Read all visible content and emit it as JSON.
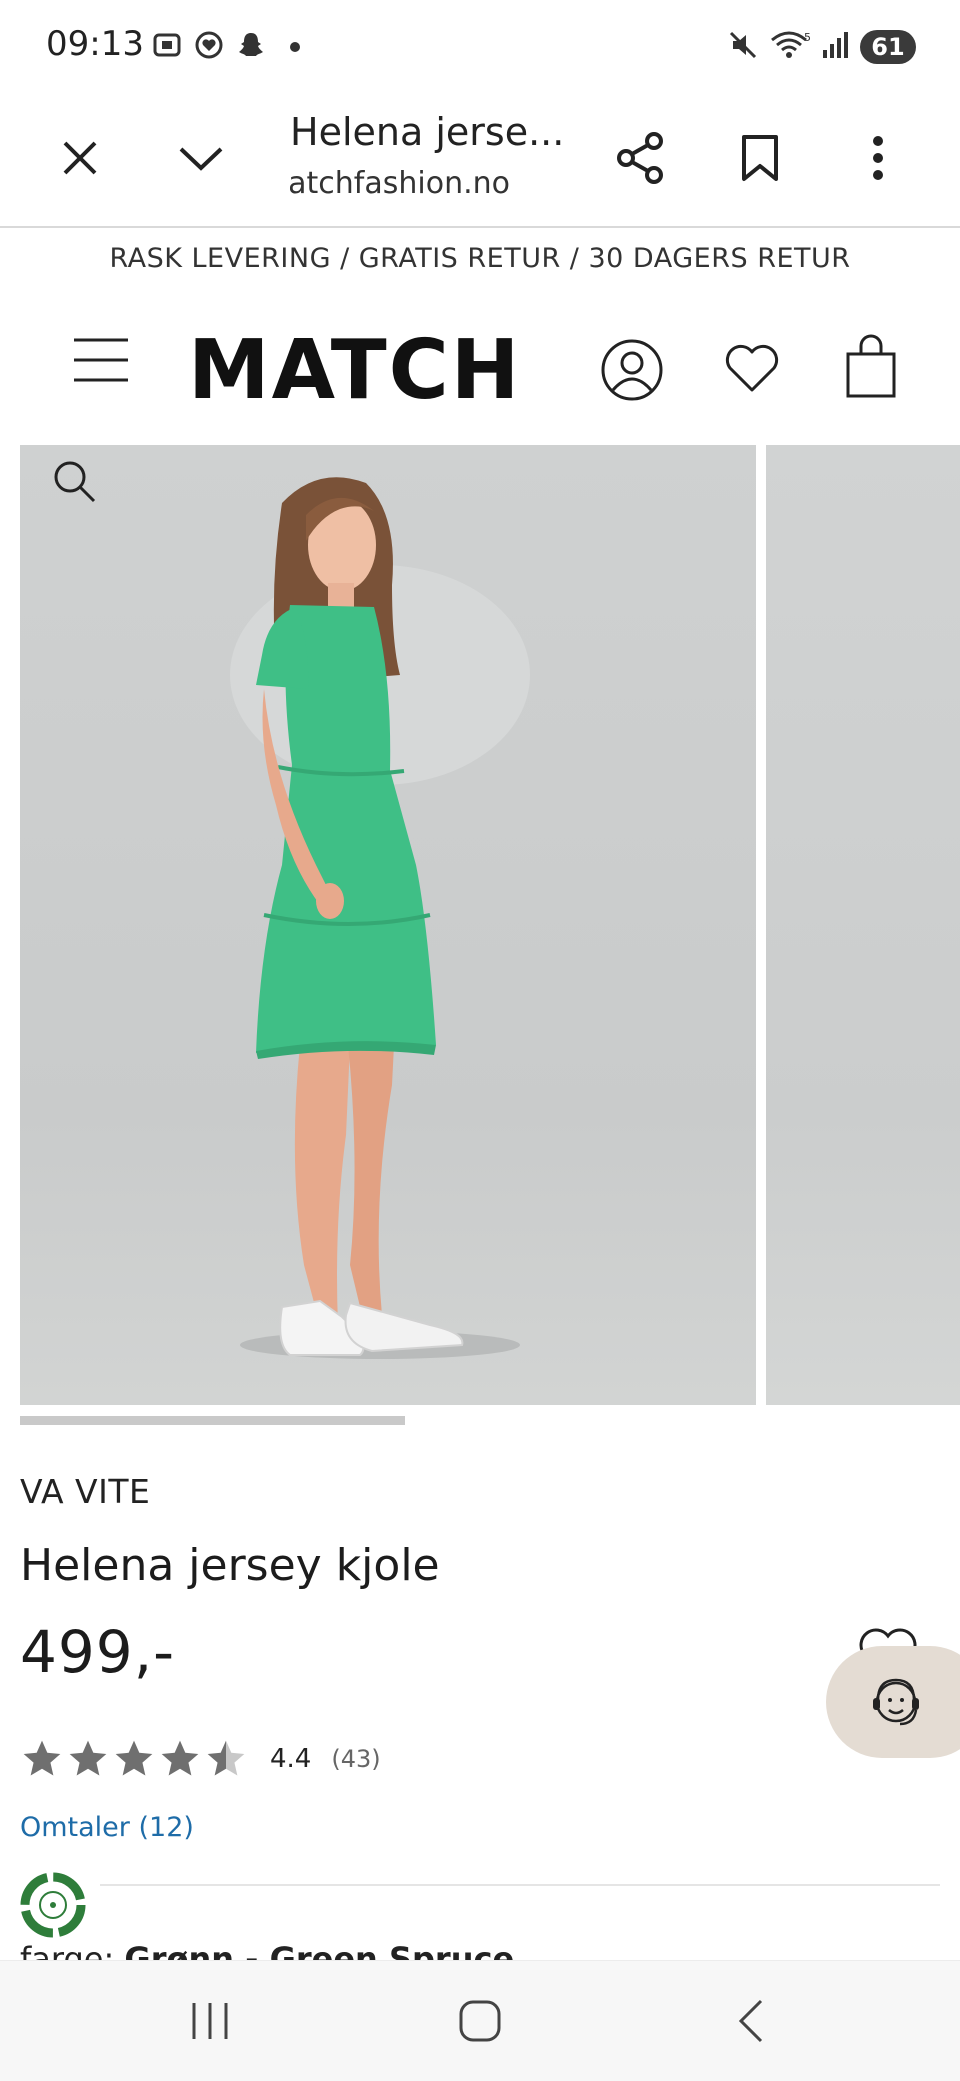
{
  "status_bar": {
    "time": "09:13",
    "battery": "61",
    "signal_badge": "5"
  },
  "browser": {
    "page_title": "Helena jerse...",
    "url": "matchfashion.no"
  },
  "promo_banner": "RASK LEVERING / GRATIS RETUR / 30 DAGERS RETUR",
  "site": {
    "logo": "MATCH"
  },
  "gallery": {
    "progress": 0.41
  },
  "product": {
    "brand": "VA VITE",
    "name": "Helena jersey kjole",
    "price": "499,-",
    "rating": {
      "value": "4.4",
      "count": "(43)",
      "stars": 4.5
    },
    "reviews_link": "Omtaler (12)",
    "color_label": "farge:",
    "color_value": "Grønn - Green Spruce"
  },
  "colors": {
    "accent_link": "#1e6ca8",
    "dress": "#3fbf86",
    "eco_badge": "#2e7d3a"
  },
  "icons": [
    "close-icon",
    "chevron-down-icon",
    "share-icon",
    "bookmark-icon",
    "more-vert-icon",
    "menu-icon",
    "account-icon",
    "heart-icon",
    "bag-icon",
    "zoom-icon",
    "chat-support-icon",
    "eco-icon",
    "recent-apps-icon",
    "home-icon",
    "back-icon"
  ]
}
